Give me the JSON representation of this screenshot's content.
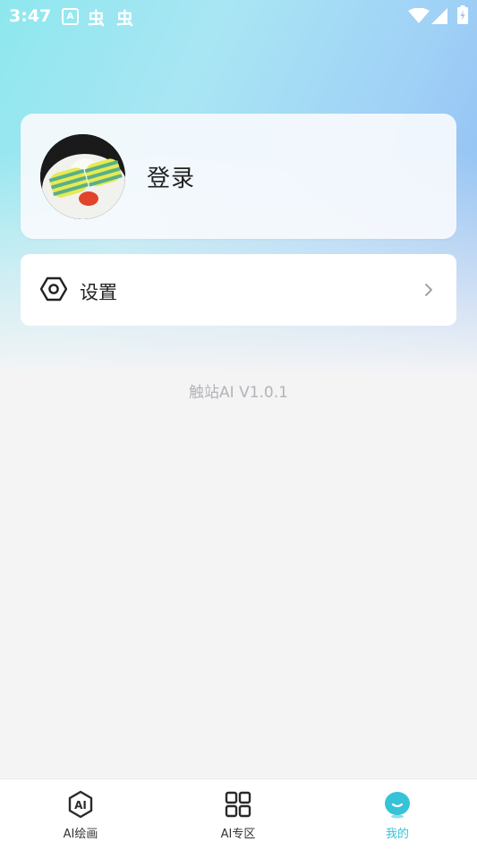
{
  "status_bar": {
    "time": "3:47",
    "notification_icons": [
      "a-icon",
      "bug-icon",
      "bug-icon"
    ],
    "bug_glyph": "虫",
    "a_glyph": "A",
    "right_icons": [
      "wifi-icon",
      "signal-icon",
      "battery-charging-icon"
    ]
  },
  "profile": {
    "login_label": "登录"
  },
  "settings": {
    "label": "设置"
  },
  "version_text": "触站AI V1.0.1",
  "tabbar": {
    "tabs": [
      {
        "label": "AI绘画",
        "icon": "ai-draw-icon",
        "active": false
      },
      {
        "label": "AI专区",
        "icon": "grid-icon",
        "active": false
      },
      {
        "label": "我的",
        "icon": "profile-face-icon",
        "active": true
      }
    ],
    "active_color": "#36c3d8",
    "icon_text": "AI"
  }
}
